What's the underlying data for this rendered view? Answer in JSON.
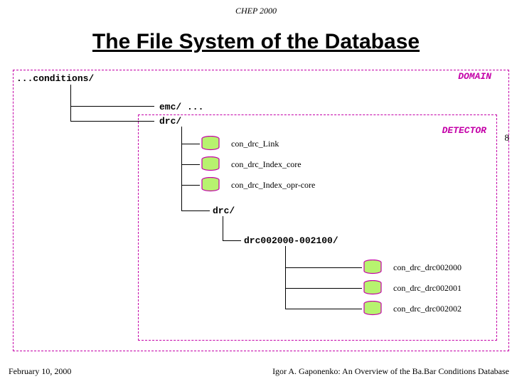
{
  "event": "CHEP 2000",
  "title": "The File System of the Database",
  "domain_label": "DOMAIN",
  "detector_label": "DETECTOR",
  "root_dir": "...conditions/",
  "children": {
    "emc": "emc/ ...",
    "drc": "drc/"
  },
  "drc_files": {
    "link": "con_drc_Link",
    "index_core": "con_drc_Index_core",
    "index_opr_core": "con_drc_Index_opr-core"
  },
  "drc_subdir": "drc/",
  "drc_run_dir": "drc002000-002100/",
  "run_files": {
    "f0": "con_drc_drc002000",
    "f1": "con_drc_drc002001",
    "f2": "con_drc_drc002002"
  },
  "page_number": "8",
  "footer": {
    "date": "February 10, 2000",
    "author": "Igor A. Gaponenko: An Overview of the Ba.Bar Conditions Database"
  }
}
